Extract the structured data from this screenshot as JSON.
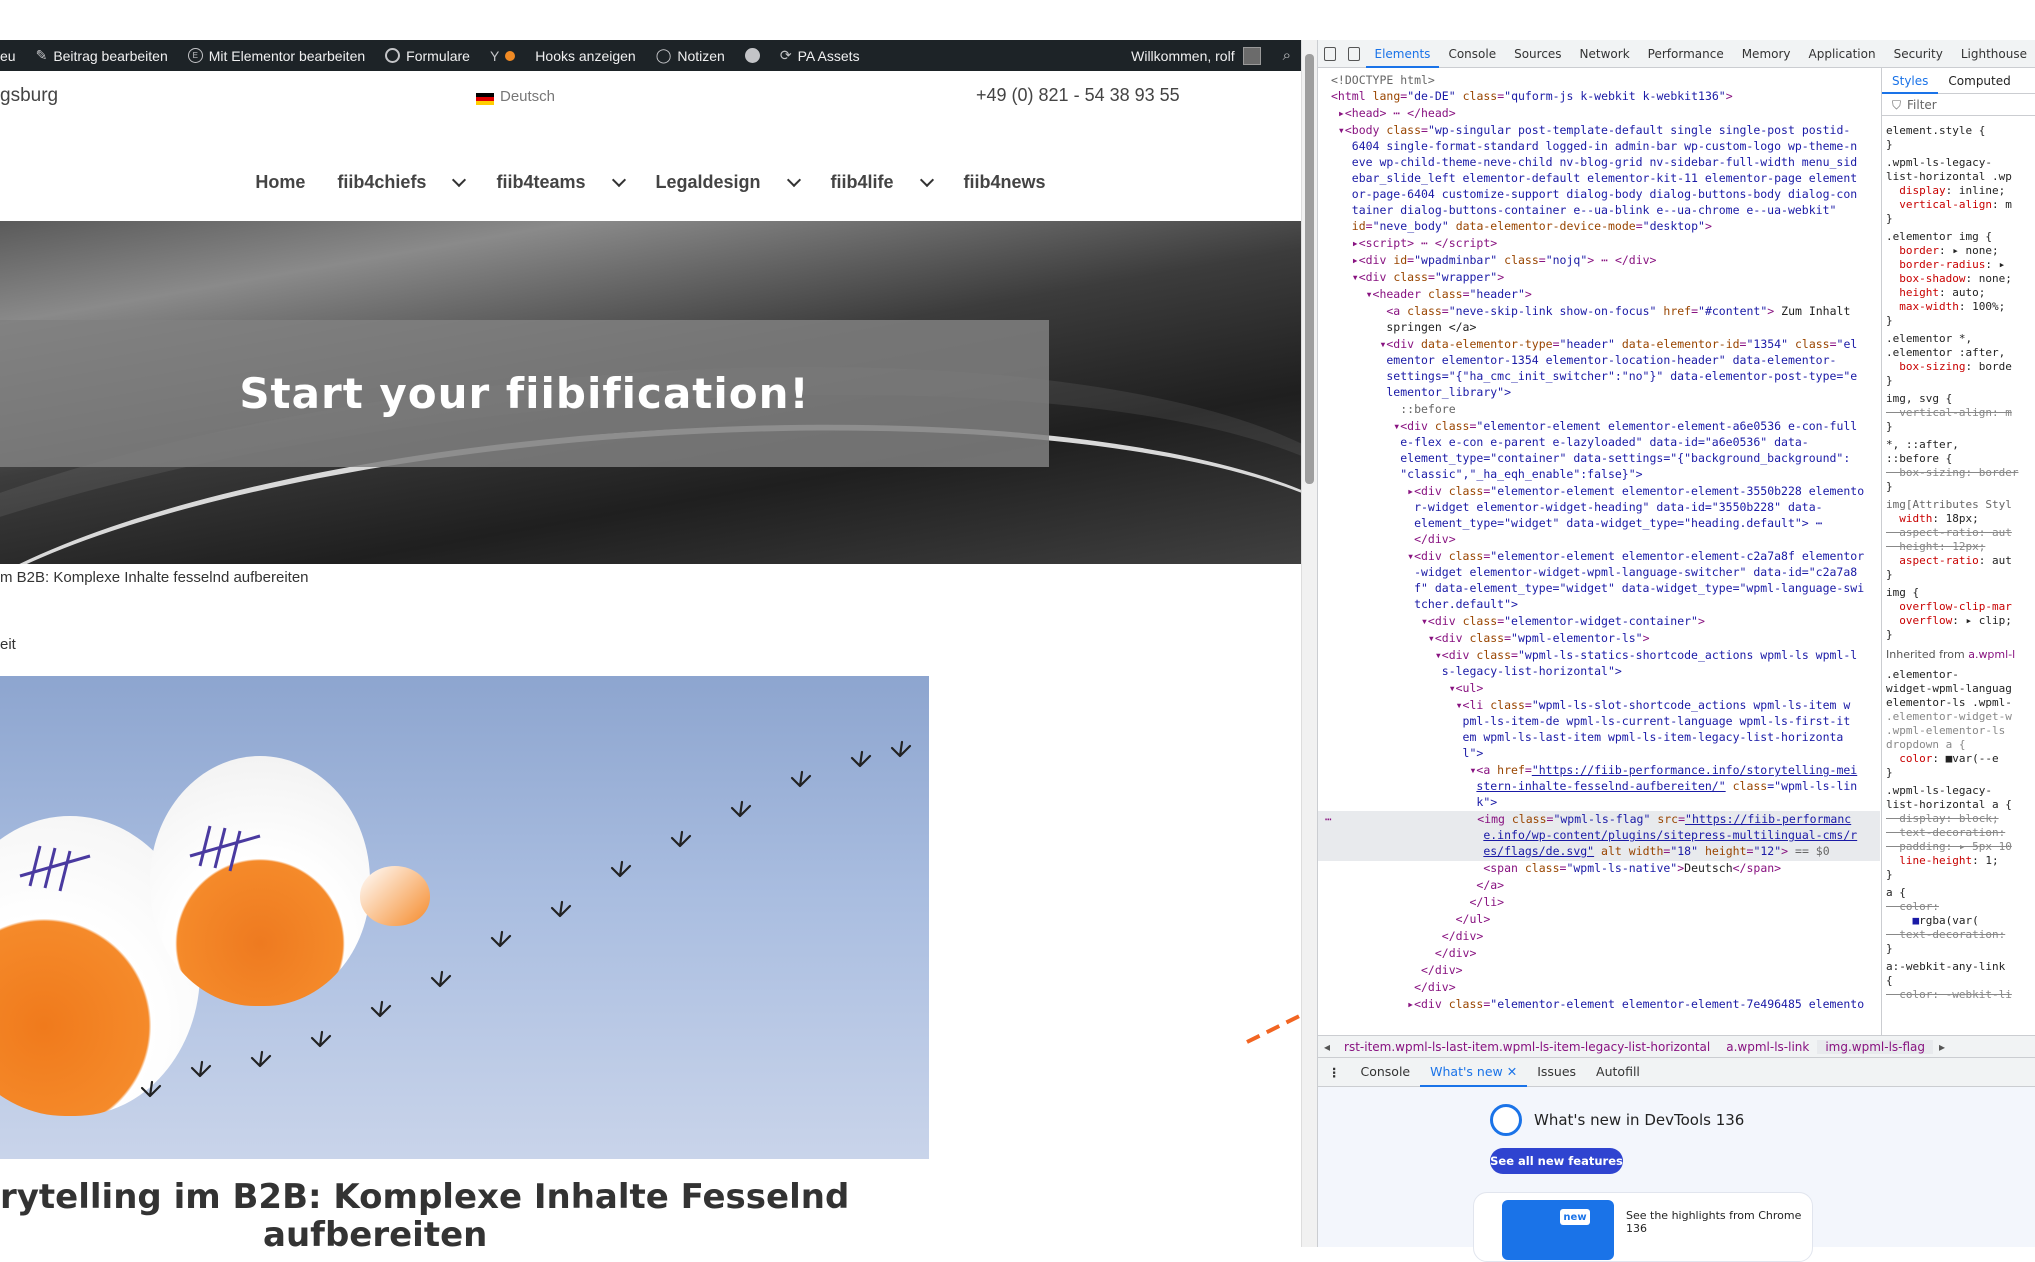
{
  "admin_bar": {
    "items": [
      "eu",
      "Beitrag bearbeiten",
      "Mit Elementor bearbeiten",
      "Formulare",
      "",
      "Hooks anzeigen",
      "Notizen",
      "",
      "PA Assets"
    ],
    "welcome": "Willkommen, rolf"
  },
  "site": {
    "site_name": "gsburg",
    "language": "Deutsch",
    "phone": "+49 (0) 821 - 54 38 93 55",
    "nav": [
      "Home",
      "fiib4chiefs",
      "fiib4teams",
      "Legaldesign",
      "fiib4life",
      "fiib4news"
    ],
    "hero_text": "Start your fiibification!",
    "breadcrumb": "m B2B: Komplexe Inhalte fesselnd aufbereiten",
    "meta": "eit",
    "post_title_line1": "rytelling im B2B: Komplexe Inhalte Fesselnd",
    "post_title_line2": "aufbereiten"
  },
  "devtools": {
    "tabs": [
      "Elements",
      "Console",
      "Sources",
      "Network",
      "Performance",
      "Memory",
      "Application",
      "Security",
      "Lighthouse"
    ],
    "active_tab": "Elements",
    "styles_tabs": [
      "Styles",
      "Computed"
    ],
    "filter_placeholder": "Filter",
    "breadcrumbs": [
      "rst-item.wpml-ls-last-item.wpml-ls-item-legacy-list-horizontal",
      "a.wpml-ls-link",
      "img.wpml-ls-flag"
    ],
    "drawer_tabs": [
      "Console",
      "What's new",
      "Issues",
      "Autofill"
    ],
    "whats_new_title": "What's new in DevTools 136",
    "see_all": "See all new features",
    "new_badge": "new",
    "highlights": "See the highlights from Chrome 136"
  },
  "colors": {
    "admin_bar_bg": "#1d2327",
    "accent": "#1a73e8",
    "arrow": "#f26522"
  }
}
